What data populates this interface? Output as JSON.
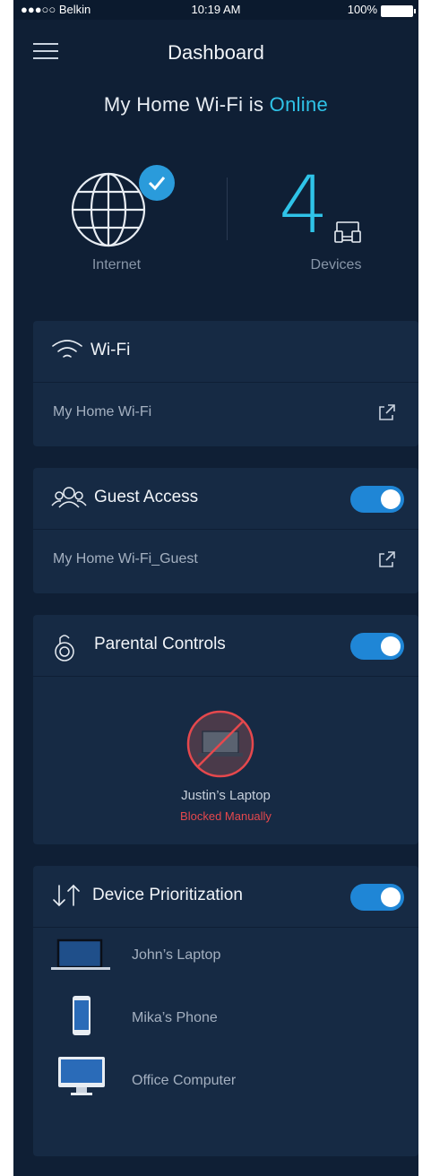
{
  "status_bar": {
    "carrier": "●●●○○ Belkin",
    "time": "10:19 AM",
    "battery": "100%"
  },
  "header": {
    "title": "Dashboard"
  },
  "network": {
    "prefix": "My Home Wi-Fi is ",
    "state": "Online"
  },
  "internet": {
    "label": "Internet"
  },
  "devices": {
    "count": "4",
    "label": "Devices"
  },
  "wifi_card": {
    "title": "Wi-Fi",
    "network_name": "My Home Wi-Fi"
  },
  "guest_card": {
    "title": "Guest Access",
    "network_name": "My Home Wi-Fi_Guest",
    "enabled": true
  },
  "parental_card": {
    "title": "Parental Controls",
    "enabled": true,
    "device_name": "Justin’s Laptop",
    "device_status": "Blocked Manually"
  },
  "prioritization_card": {
    "title": "Device Prioritization",
    "enabled": true,
    "devices": [
      {
        "name": "John’s Laptop",
        "icon": "laptop-icon"
      },
      {
        "name": "Mika’s Phone",
        "icon": "phone-icon"
      },
      {
        "name": "Office Computer",
        "icon": "desktop-icon"
      }
    ]
  },
  "colors": {
    "background": "#0f1f35",
    "card": "#162a44",
    "accent": "#2fc3e8",
    "toggle": "#1f86d6",
    "blocked": "#e5484d"
  }
}
